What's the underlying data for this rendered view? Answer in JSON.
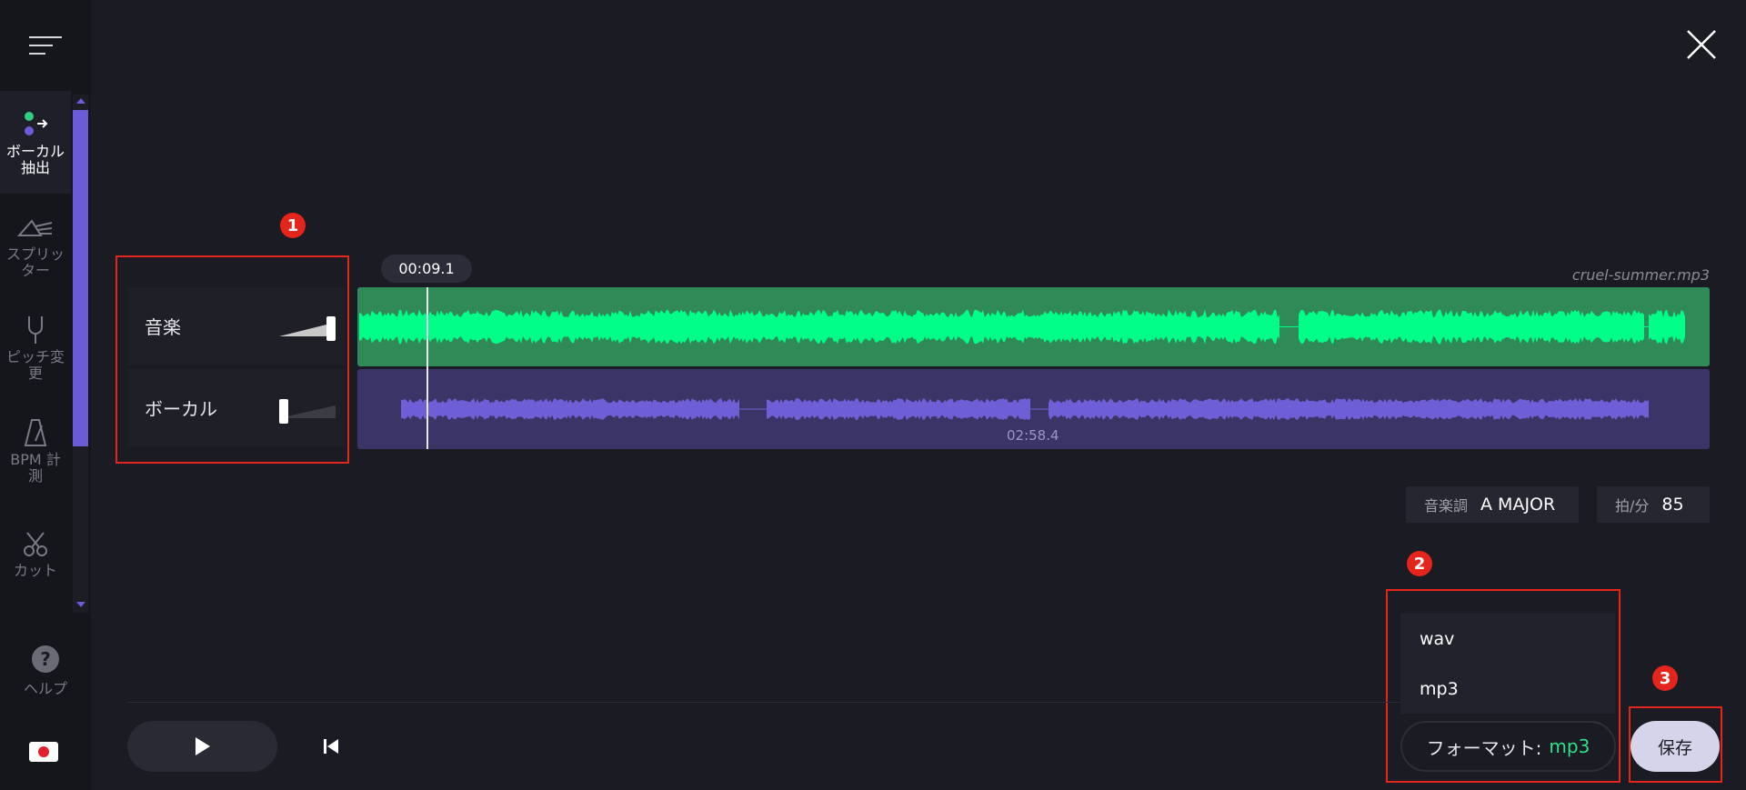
{
  "sidebar": {
    "menu_icon": "hamburger-icon",
    "items": [
      {
        "label": "ボーカル\n抽出",
        "icon": "vocal-extract-icon",
        "active": true
      },
      {
        "label": "スプリッ\nター",
        "icon": "splitter-icon",
        "active": false
      },
      {
        "label": "ピッチ変\n更",
        "icon": "tuning-fork-icon",
        "active": false
      },
      {
        "label": "BPM 計\n測",
        "icon": "metronome-icon",
        "active": false
      },
      {
        "label": "カット",
        "icon": "scissors-icon",
        "active": false
      }
    ],
    "help_label": "ヘルプ",
    "help_glyph": "?"
  },
  "annotations": [
    "1",
    "2",
    "3"
  ],
  "mixer": {
    "tracks": [
      {
        "name": "音楽",
        "level": 1.0
      },
      {
        "name": "ボーカル",
        "level": 0.0
      }
    ]
  },
  "timeline": {
    "current_time": "00:09.1",
    "filename": "cruel-summer.mp3",
    "duration": "02:58.4",
    "music_color": "#00ff88",
    "vocal_color": "#6f5fd6"
  },
  "info": {
    "key_label": "音楽調",
    "key_value": "A MAJOR",
    "bpm_label": "拍/分",
    "bpm_value": "85"
  },
  "export": {
    "options": [
      "wav",
      "mp3"
    ],
    "format_label": "フォーマット:",
    "format_value": "mp3",
    "save_label": "保存"
  }
}
